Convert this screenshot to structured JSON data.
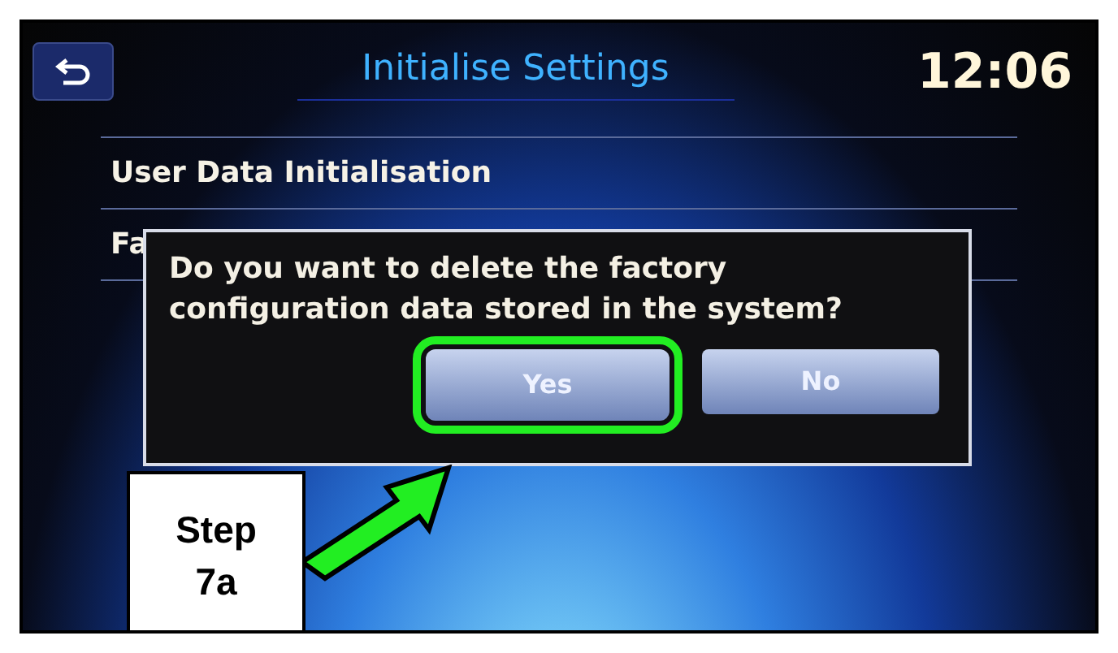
{
  "header": {
    "title": "Initialise Settings",
    "clock": "12:06"
  },
  "items": [
    {
      "label": "User Data Initialisation"
    },
    {
      "label": "Fa"
    }
  ],
  "dialog": {
    "message": "Do you want to delete the factory configuration data stored in the system?",
    "buttons": [
      {
        "label": "Yes",
        "highlighted": true
      },
      {
        "label": "No",
        "highlighted": false
      }
    ]
  },
  "callout": {
    "text": "Step\n7a"
  }
}
